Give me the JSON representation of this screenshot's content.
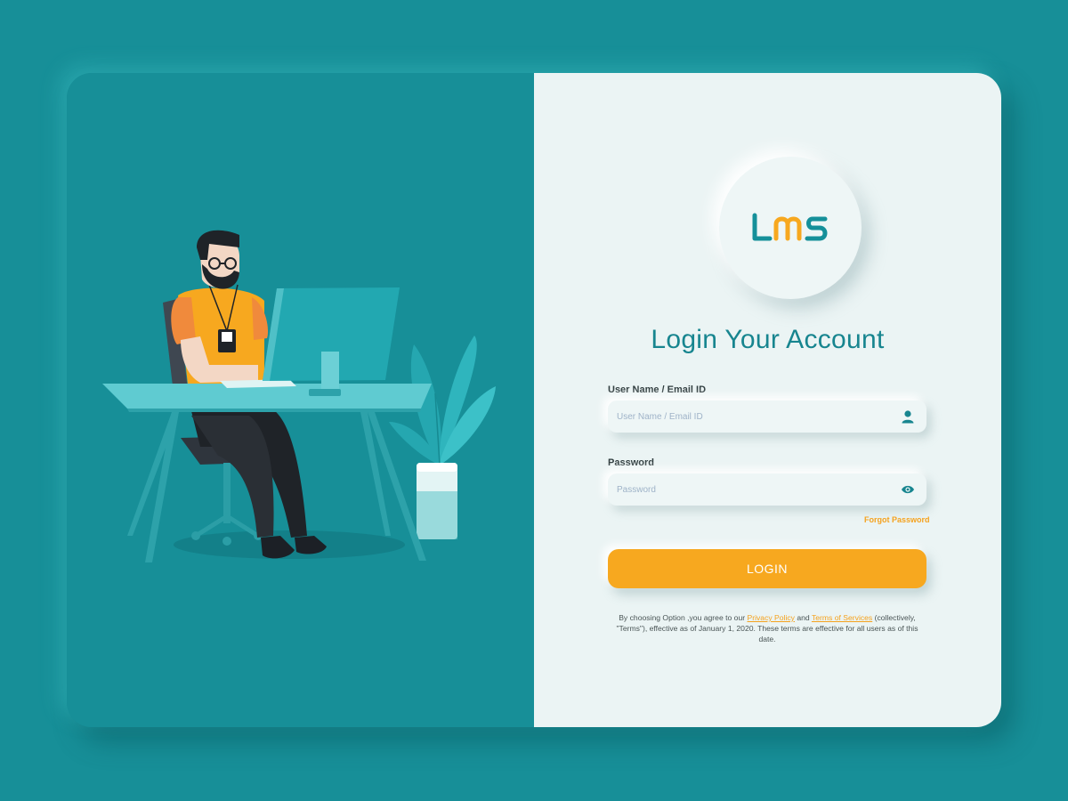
{
  "brand": {
    "logo_text": "LMS",
    "colors": {
      "accent": "#f7a81f",
      "primary": "#178f98",
      "panel": "#ebf4f4"
    }
  },
  "login": {
    "title": "Login Your Account",
    "username": {
      "label": "User Name / Email ID",
      "placeholder": "User Name / Email ID",
      "value": "",
      "icon": "user-icon"
    },
    "password": {
      "label": "Password",
      "placeholder": "Password",
      "value": "",
      "icon": "eye-icon"
    },
    "forgot_label": "Forgot Password",
    "submit_label": "LOGIN"
  },
  "terms": {
    "prefix": "By choosing Option ,you agree to our",
    "privacy_label": "Privacy Policy",
    "and": "and",
    "tos_label": "Terms of Services",
    "suffix": "(collectively, \"Terms\"), effective as of January 1, 2020. These terms are effective for all users as of this date."
  }
}
